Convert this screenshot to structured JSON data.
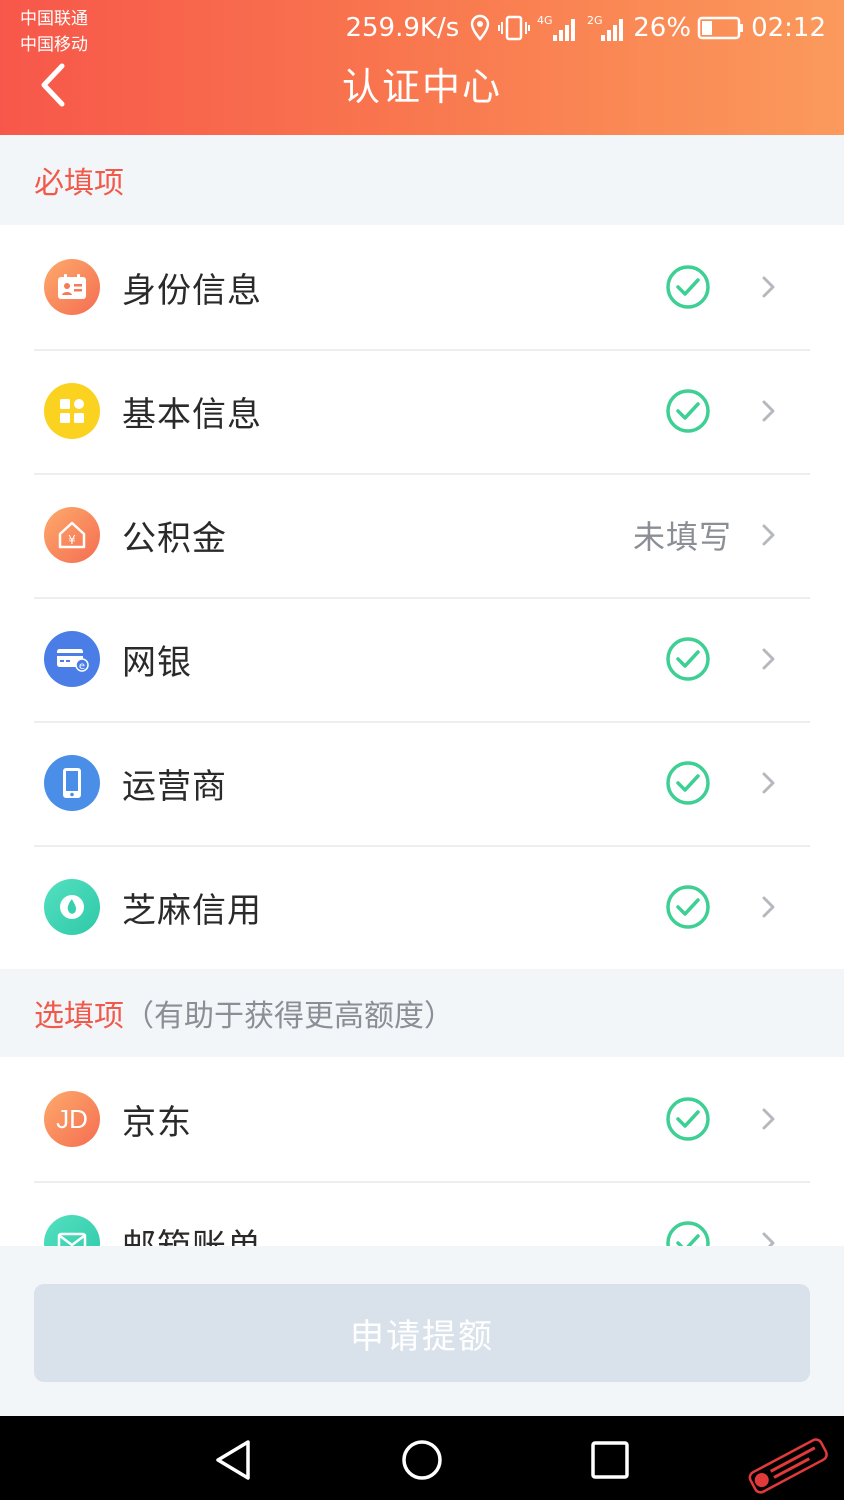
{
  "status_bar": {
    "carrier1": "中国联通",
    "carrier2": "中国移动",
    "speed": "259.9K/s",
    "battery": "26%",
    "time": "02:12"
  },
  "header": {
    "title": "认证中心"
  },
  "required_section": {
    "title": "必填项"
  },
  "required_items": [
    {
      "label": "身份信息",
      "status": "done",
      "icon": "id-card-icon"
    },
    {
      "label": "基本信息",
      "status": "done",
      "icon": "grid-icon"
    },
    {
      "label": "公积金",
      "status": "pending",
      "status_text": "未填写",
      "icon": "house-yuan-icon"
    },
    {
      "label": "网银",
      "status": "done",
      "icon": "bank-card-icon"
    },
    {
      "label": "运营商",
      "status": "done",
      "icon": "phone-icon"
    },
    {
      "label": "芝麻信用",
      "status": "done",
      "icon": "sesame-icon"
    }
  ],
  "optional_section": {
    "title": "选填项",
    "hint": "（有助于获得更高额度）"
  },
  "optional_items": [
    {
      "label": "京东",
      "status": "done",
      "icon": "jd-icon",
      "icon_text": "JD"
    },
    {
      "label": "邮箱账单",
      "status": "done",
      "icon": "mail-icon"
    }
  ],
  "apply_button": {
    "label": "申请提额"
  },
  "colors": {
    "header_start": "#f7574a",
    "header_end": "#fb9a5c",
    "accent_red": "#f1594a",
    "check_green": "#3ecf95",
    "button_disabled": "#d9e2ea"
  }
}
